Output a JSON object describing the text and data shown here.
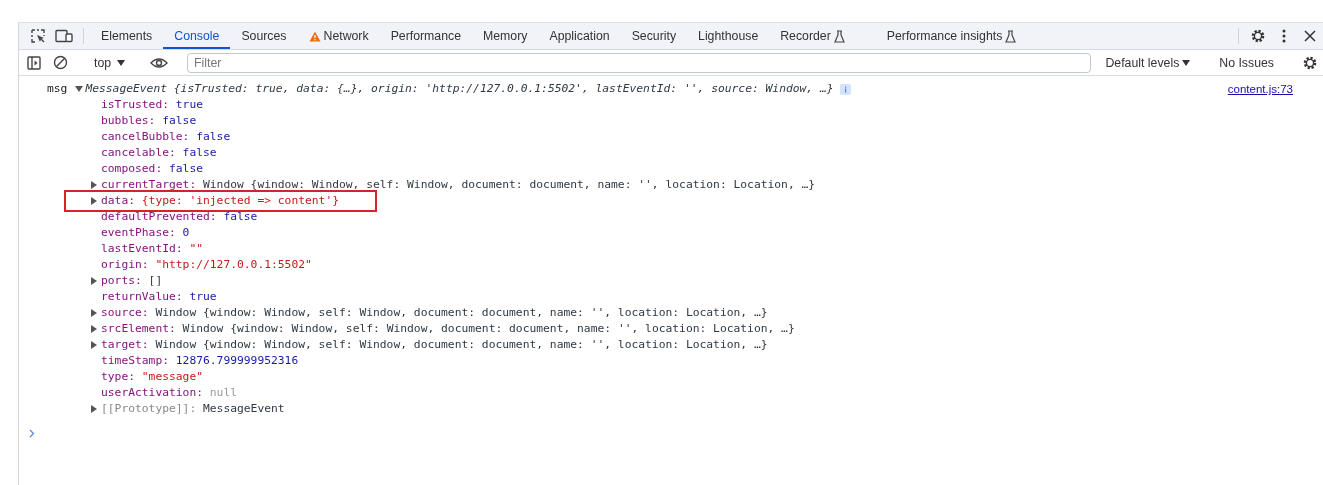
{
  "tabs": [
    {
      "label": "Elements",
      "selected": false,
      "kind": "plain"
    },
    {
      "label": "Console",
      "selected": true,
      "kind": "plain"
    },
    {
      "label": "Sources",
      "selected": false,
      "kind": "plain"
    },
    {
      "label": "Network",
      "selected": false,
      "kind": "warning"
    },
    {
      "label": "Performance",
      "selected": false,
      "kind": "plain"
    },
    {
      "label": "Memory",
      "selected": false,
      "kind": "plain"
    },
    {
      "label": "Application",
      "selected": false,
      "kind": "plain"
    },
    {
      "label": "Security",
      "selected": false,
      "kind": "plain"
    },
    {
      "label": "Lighthouse",
      "selected": false,
      "kind": "plain"
    },
    {
      "label": "Recorder",
      "selected": false,
      "kind": "experiment"
    },
    {
      "label": "Performance insights",
      "selected": false,
      "kind": "experiment"
    }
  ],
  "toolbar": {
    "context": "top",
    "filter": {
      "placeholder": "Filter"
    },
    "levels": "Default levels",
    "issues": "No Issues"
  },
  "log": {
    "label": "msg",
    "expanded": true,
    "source": "content.js:73",
    "preview": "MessageEvent {isTrusted: true, data: {…}, origin: 'http://127.0.0.1:5502', lastEventId: '', source: Window, …}",
    "properties": [
      {
        "key": "isTrusted:",
        "value": "true",
        "kind": "literal",
        "expandable": false,
        "highlighted": false
      },
      {
        "key": "bubbles:",
        "value": "false",
        "kind": "literal",
        "expandable": false,
        "highlighted": false
      },
      {
        "key": "cancelBubble:",
        "value": "false",
        "kind": "literal",
        "expandable": false,
        "highlighted": false
      },
      {
        "key": "cancelable:",
        "value": "false",
        "kind": "literal",
        "expandable": false,
        "highlighted": false
      },
      {
        "key": "composed:",
        "value": "false",
        "kind": "literal",
        "expandable": false,
        "highlighted": false
      },
      {
        "key": "currentTarget:",
        "value": "Window {window: Window, self: Window, document: document, name: '', location: Location, …}",
        "kind": "object",
        "expandable": true,
        "highlighted": false
      },
      {
        "key": "data:",
        "value": "{type: 'injected => content'}",
        "kind": "string",
        "expandable": true,
        "highlighted": true
      },
      {
        "key": "defaultPrevented:",
        "value": "false",
        "kind": "literal",
        "expandable": false,
        "highlighted": false
      },
      {
        "key": "eventPhase:",
        "value": "0",
        "kind": "literal",
        "expandable": false,
        "highlighted": false
      },
      {
        "key": "lastEventId:",
        "value": "\"\"",
        "kind": "string",
        "expandable": false,
        "highlighted": false
      },
      {
        "key": "origin:",
        "value": "\"http://127.0.0.1:5502\"",
        "kind": "string",
        "expandable": false,
        "highlighted": false
      },
      {
        "key": "ports:",
        "value": "[]",
        "kind": "plain",
        "expandable": true,
        "highlighted": false
      },
      {
        "key": "returnValue:",
        "value": "true",
        "kind": "literal",
        "expandable": false,
        "highlighted": false
      },
      {
        "key": "source:",
        "value": "Window {window: Window, self: Window, document: document, name: '', location: Location, …}",
        "kind": "object",
        "expandable": true,
        "highlighted": false
      },
      {
        "key": "srcElement:",
        "value": "Window {window: Window, self: Window, document: document, name: '', location: Location, …}",
        "kind": "object",
        "expandable": true,
        "highlighted": false
      },
      {
        "key": "target:",
        "value": "Window {window: Window, self: Window, document: document, name: '', location: Location, …}",
        "kind": "object",
        "expandable": true,
        "highlighted": false
      },
      {
        "key": "timeStamp:",
        "value": "12876.799999952316",
        "kind": "literal",
        "expandable": false,
        "highlighted": false
      },
      {
        "key": "type:",
        "value": "\"message\"",
        "kind": "string",
        "expandable": false,
        "highlighted": false
      },
      {
        "key": "userActivation:",
        "value": "null",
        "kind": "null",
        "expandable": false,
        "highlighted": false
      },
      {
        "key": "[[Prototype]]:",
        "value": "MessageEvent",
        "kind": "plain",
        "expandable": true,
        "highlighted": false,
        "internal": true
      }
    ]
  }
}
